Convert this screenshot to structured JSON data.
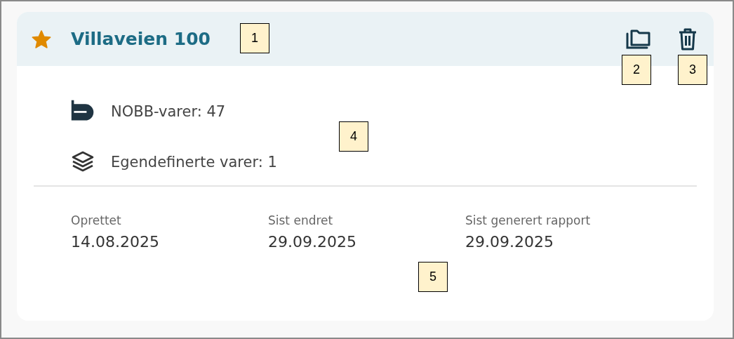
{
  "card": {
    "title": "Villaveien 100",
    "favorite": true,
    "stats": [
      {
        "kind": "nobb",
        "text": "NOBB-varer: 47"
      },
      {
        "kind": "custom",
        "text": "Egendefinerte varer: 1"
      }
    ],
    "dates": [
      {
        "label": "Oprettet",
        "value": "14.08.2025"
      },
      {
        "label": "Sist endret",
        "value": "29.09.2025"
      },
      {
        "label": "Sist generert rapport",
        "value": "29.09.2025"
      }
    ]
  },
  "callouts": [
    {
      "label": "1"
    },
    {
      "label": "2"
    },
    {
      "label": "3"
    },
    {
      "label": "4"
    },
    {
      "label": "5"
    }
  ]
}
